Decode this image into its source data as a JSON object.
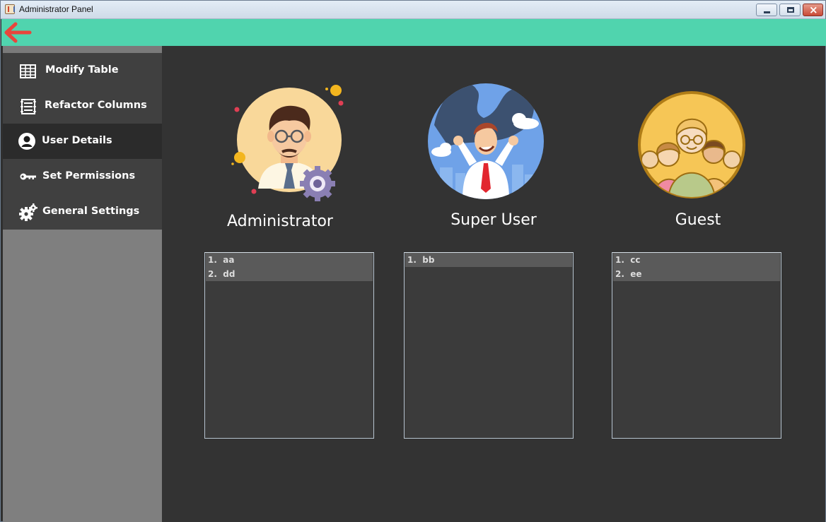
{
  "window": {
    "title": "Administrator Panel"
  },
  "topbar": {
    "back_icon": "arrow-left-icon",
    "accent_color": "#50d4ae"
  },
  "sidebar": {
    "items": [
      {
        "label": "Modify Table",
        "icon": "table-grid-icon",
        "active": false
      },
      {
        "label": "Refactor Columns",
        "icon": "columns-list-icon",
        "active": false
      },
      {
        "label": "User Details",
        "icon": "user-icon",
        "active": true
      },
      {
        "label": "Set Permissions",
        "icon": "key-icon",
        "active": false
      },
      {
        "label": "General Settings",
        "icon": "gears-icon",
        "active": false
      }
    ]
  },
  "roles": [
    {
      "name": "Administrator",
      "icon": "administrator-avatar-icon",
      "entries": [
        "1.  aa",
        "2.  dd"
      ]
    },
    {
      "name": "Super User",
      "icon": "super-user-avatar-icon",
      "entries": [
        "1.  bb"
      ]
    },
    {
      "name": "Guest",
      "icon": "guest-group-avatar-icon",
      "entries": [
        "1.  cc",
        "2.  ee"
      ]
    }
  ]
}
